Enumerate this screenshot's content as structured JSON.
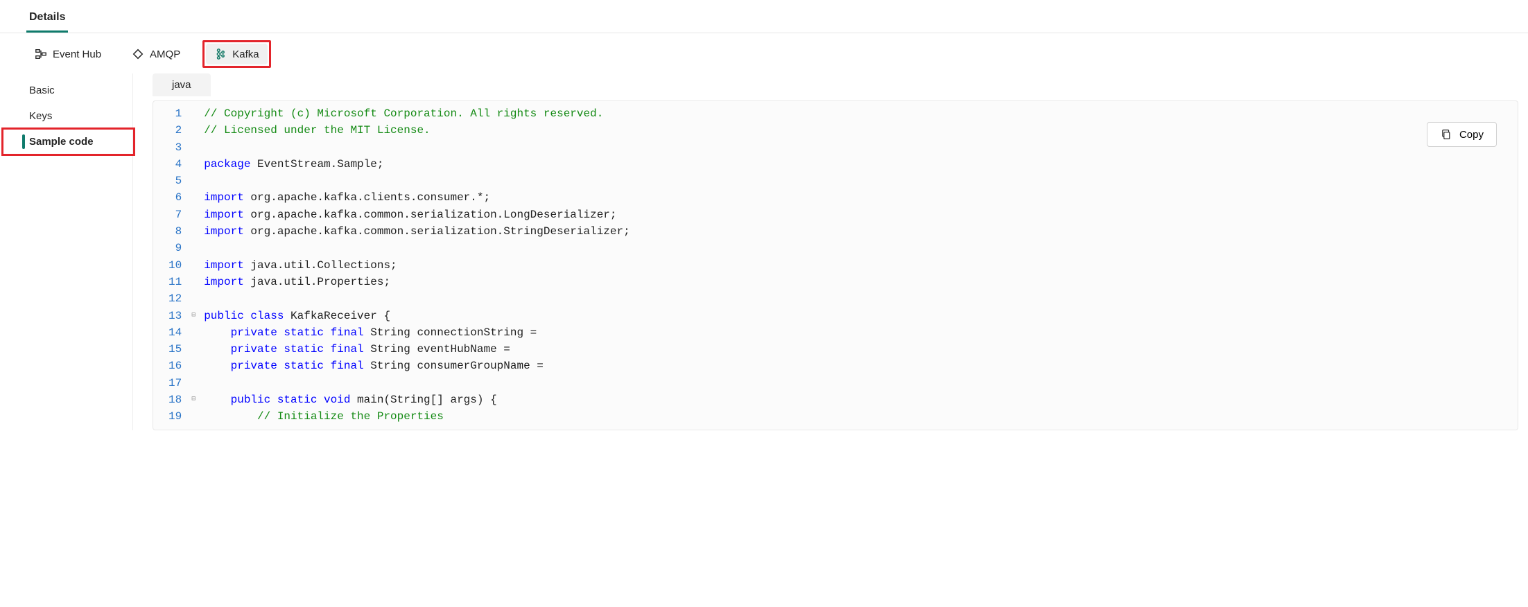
{
  "header": {
    "tab_details": "Details"
  },
  "toolbar": {
    "event_hub": "Event Hub",
    "amqp": "AMQP",
    "kafka": "Kafka"
  },
  "sidebar": {
    "items": [
      {
        "label": "Basic"
      },
      {
        "label": "Keys"
      },
      {
        "label": "Sample code"
      }
    ]
  },
  "code_tabs": {
    "java": "java"
  },
  "copy_label": "Copy",
  "code": {
    "line_count": 19,
    "fold_markers": {
      "13": "⊟",
      "18": "⊟"
    },
    "lines": [
      [
        {
          "t": "comment",
          "v": "// Copyright (c) Microsoft Corporation. All rights reserved."
        }
      ],
      [
        {
          "t": "comment",
          "v": "// Licensed under the MIT License."
        }
      ],
      [],
      [
        {
          "t": "keyword",
          "v": "package"
        },
        {
          "t": "plain",
          "v": " EventStream.Sample;"
        }
      ],
      [],
      [
        {
          "t": "keyword",
          "v": "import"
        },
        {
          "t": "plain",
          "v": " org.apache.kafka.clients.consumer.*;"
        }
      ],
      [
        {
          "t": "keyword",
          "v": "import"
        },
        {
          "t": "plain",
          "v": " org.apache.kafka.common.serialization.LongDeserializer;"
        }
      ],
      [
        {
          "t": "keyword",
          "v": "import"
        },
        {
          "t": "plain",
          "v": " org.apache.kafka.common.serialization.StringDeserializer;"
        }
      ],
      [],
      [
        {
          "t": "keyword",
          "v": "import"
        },
        {
          "t": "plain",
          "v": " java.util.Collections;"
        }
      ],
      [
        {
          "t": "keyword",
          "v": "import"
        },
        {
          "t": "plain",
          "v": " java.util.Properties;"
        }
      ],
      [],
      [
        {
          "t": "keyword",
          "v": "public class"
        },
        {
          "t": "plain",
          "v": " KafkaReceiver {"
        }
      ],
      [
        {
          "t": "plain",
          "v": "    "
        },
        {
          "t": "keyword",
          "v": "private static final"
        },
        {
          "t": "plain",
          "v": " String connectionString ="
        }
      ],
      [
        {
          "t": "plain",
          "v": "    "
        },
        {
          "t": "keyword",
          "v": "private static final"
        },
        {
          "t": "plain",
          "v": " String eventHubName ="
        }
      ],
      [
        {
          "t": "plain",
          "v": "    "
        },
        {
          "t": "keyword",
          "v": "private static final"
        },
        {
          "t": "plain",
          "v": " String consumerGroupName ="
        }
      ],
      [],
      [
        {
          "t": "plain",
          "v": "    "
        },
        {
          "t": "keyword",
          "v": "public static void"
        },
        {
          "t": "plain",
          "v": " main(String[] args) {"
        }
      ],
      [
        {
          "t": "plain",
          "v": "        "
        },
        {
          "t": "comment",
          "v": "// Initialize the Properties"
        }
      ]
    ]
  }
}
